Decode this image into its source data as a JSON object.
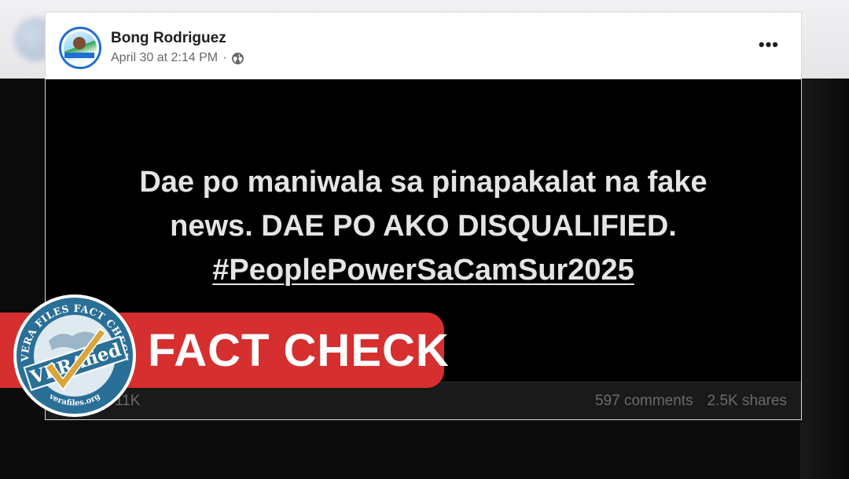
{
  "post": {
    "author": "Bong Rodriguez",
    "timestamp": "April 30 at 2:14 PM",
    "separator": "·",
    "privacy_icon": "globe-icon",
    "more_label": "•••",
    "text_line1": "Dae po maniwala sa pinapakalat na fake",
    "text_line2": "news. DAE PO AKO DISQUALIFIED.",
    "hashtag": "#PeoplePowerSaCamSur2025",
    "reaction_count": "11K",
    "comments": "597 comments",
    "shares": "2.5K shares"
  },
  "overlay": {
    "banner_label": "FACT CHECK",
    "seal_top_text": "VERA FILES FACT CHECK",
    "seal_center_text": "VERAfied",
    "seal_bottom_text": "verafiles.org",
    "banner_color": "#d52f2f",
    "seal_color": "#2a6f97"
  }
}
